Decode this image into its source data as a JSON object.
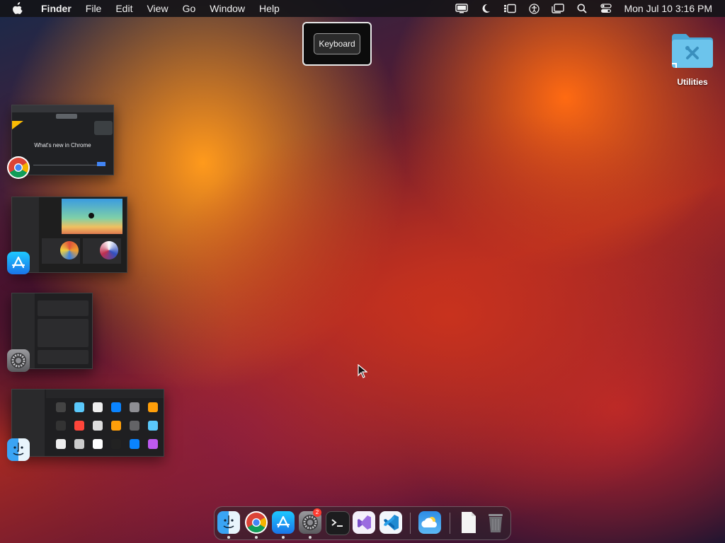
{
  "menubar": {
    "app_name": "Finder",
    "menus": [
      "File",
      "Edit",
      "View",
      "Go",
      "Window",
      "Help"
    ],
    "status_icons": [
      "display-icon",
      "moon-icon",
      "stage-manager-icon",
      "accessibility-icon",
      "window-icon",
      "search-icon",
      "control-center-icon"
    ],
    "clock": "Mon Jul 10  3:16 PM"
  },
  "tooltip": {
    "keyboard_label": "Keyboard"
  },
  "desktop": {
    "folder_label": "Utilities"
  },
  "expose": {
    "chrome_thumb_title": "What's new in Chrome"
  },
  "dock": {
    "items": [
      "Finder",
      "Google Chrome",
      "App Store",
      "System Settings",
      "Terminal",
      "Visual Studio",
      "Visual Studio Code",
      "Weather",
      "Document",
      "Trash"
    ],
    "settings_badge": "2"
  },
  "colors": {
    "menubar_bg": "#141418",
    "accent_orange": "#ff8a1c",
    "accent_red": "#c8321e",
    "folder_blue": "#5fb8e6"
  }
}
